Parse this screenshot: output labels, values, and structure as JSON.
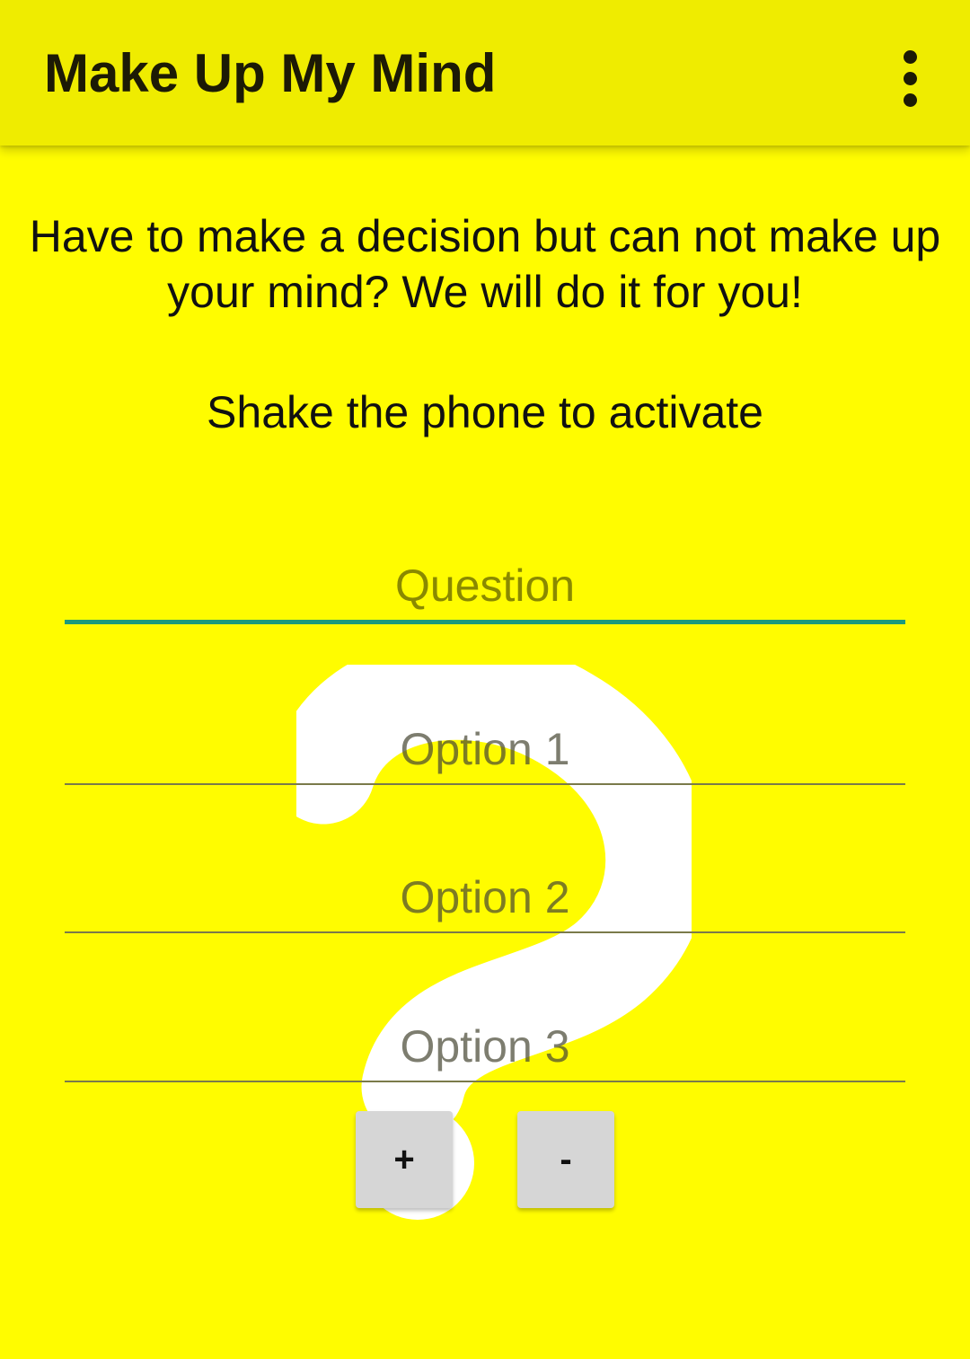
{
  "appbar": {
    "title": "Make Up My Mind",
    "menu_icon": "more-vert-icon"
  },
  "content": {
    "intro": "Have to make a decision but can not make up your mind? We will do it for you!",
    "instruction": "Shake the phone to activate"
  },
  "form": {
    "question_placeholder": "Question",
    "option1_placeholder": "Option 1",
    "option2_placeholder": "Option 2",
    "option3_placeholder": "Option 3"
  },
  "buttons": {
    "add_label": "+",
    "remove_label": "-"
  },
  "background_icon": "question-mark-icon",
  "colors": {
    "background": "#fffc00",
    "appbar": "#efec00",
    "accent": "#1b9a7c",
    "button": "#d6d6d6"
  }
}
